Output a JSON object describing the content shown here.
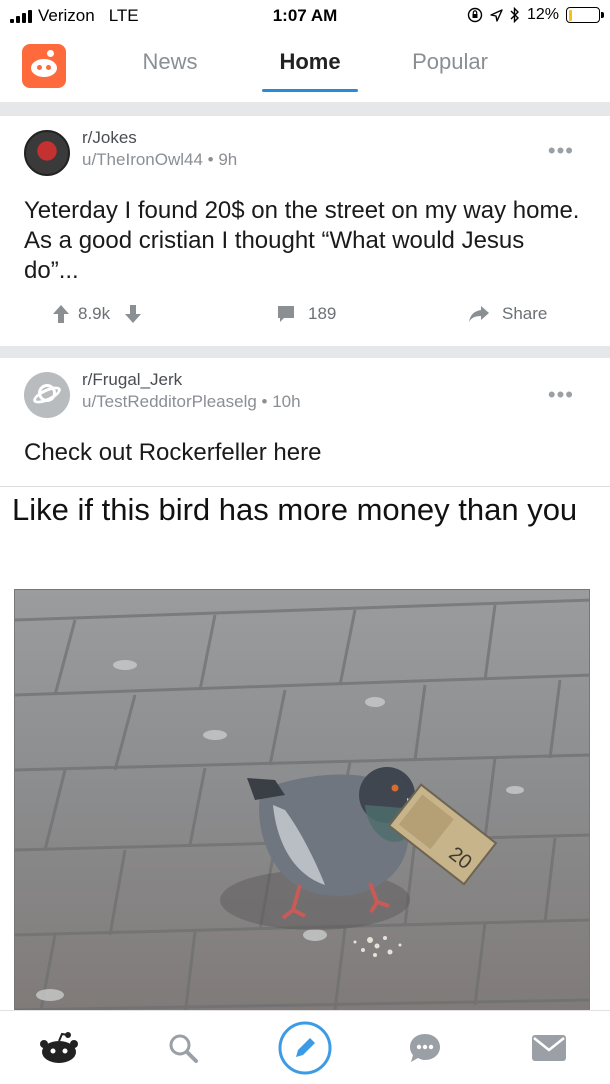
{
  "status_bar": {
    "carrier": "Verizon",
    "network": "LTE",
    "time": "1:07 AM",
    "battery": "12%",
    "battery_level": 0.12
  },
  "nav": {
    "tabs": [
      "News",
      "Home",
      "Popular"
    ],
    "active_tab": "Home",
    "accent_color": "#2b8ad8",
    "logo_color": "#ff6a3d"
  },
  "posts": [
    {
      "subreddit": "r/Jokes",
      "user_line": "u/TheIronOwl44 • 9h",
      "title": "Yeterday I found 20$ on the street on my way home. As a good cristian I thought “What would Jesus do”...",
      "upvotes": "8.9k",
      "comments": "189",
      "share": "Share"
    },
    {
      "subreddit": "r/Frugal_Jerk",
      "user_line": "u/TestRedditorPleaselg • 10h",
      "title": "Check out Rockerfeller here",
      "image_caption": "Like if this bird has more money than you"
    }
  ],
  "more_glyph": "•••",
  "tab_bar": {
    "icons": [
      "reddit-home-icon",
      "search-icon",
      "compose-icon",
      "chat-icon",
      "mail-icon"
    ]
  }
}
